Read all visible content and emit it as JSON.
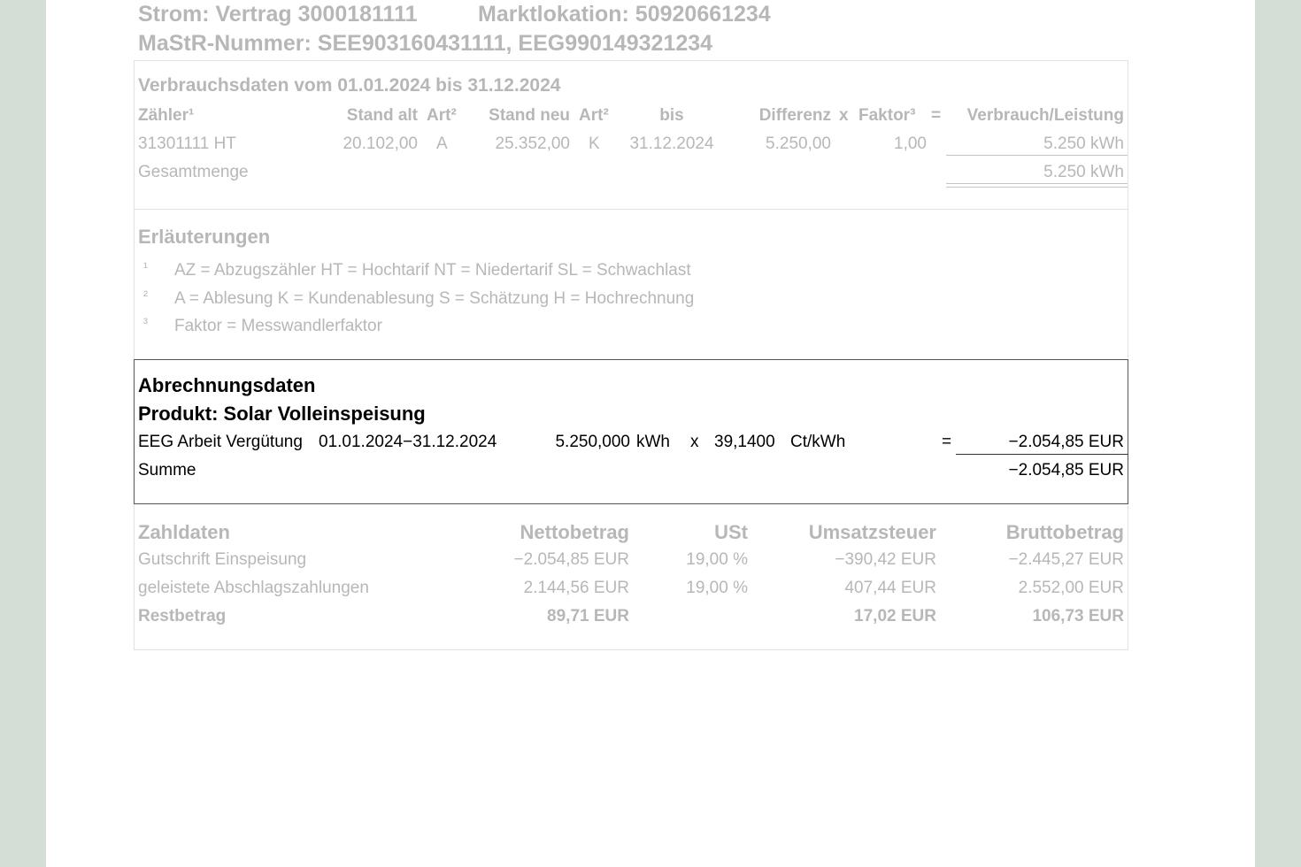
{
  "header": {
    "line1_contract": "Strom: Vertrag 3000181111",
    "line1_location": "Marktlokation: 50920661234",
    "line2": "MaStR-Nummer: SEE903160431111, EEG990149321234"
  },
  "consumption": {
    "title": "Verbrauchsdaten vom 01.01.2024 bis 31.12.2024",
    "headers": {
      "meter": "Zähler¹",
      "stand_alt": "Stand alt",
      "art1": "Art²",
      "stand_neu": "Stand neu",
      "art2": "Art²",
      "bis": "bis",
      "differenz": "Differenz",
      "x": "x",
      "faktor": "Faktor³",
      "eq": "=",
      "verbrauch": "Verbrauch/Leistung"
    },
    "row": {
      "meter": "31301111 HT",
      "stand_alt": "20.102,00",
      "art1": "A",
      "stand_neu": "25.352,00",
      "art2": "K",
      "bis": "31.12.2024",
      "differenz": "5.250,00",
      "faktor": "1,00",
      "verbrauch": "5.250 kWh"
    },
    "total_label": "Gesamtmenge",
    "total_value": "5.250 kWh"
  },
  "notes": {
    "title": "Erläuterungen",
    "items": [
      {
        "mark": "¹",
        "text": "AZ = Abzugszähler  HT = Hochtarif  NT = Niedertarif  SL = Schwachlast"
      },
      {
        "mark": "²",
        "text": "A = Ablesung  K = Kundenablesung  S = Schätzung  H = Hochrechnung"
      },
      {
        "mark": "³",
        "text": "Faktor = Messwandlerfaktor"
      }
    ]
  },
  "billing": {
    "title": "Abrechnungsdaten",
    "product": "Produkt: Solar Volleinspeisung",
    "line": {
      "label": "EEG Arbeit Vergütung",
      "period": "01.01.2024−31.12.2024",
      "qty": "5.250,000",
      "qty_unit": "kWh",
      "x": "x",
      "price": "39,1400",
      "price_unit": "Ct/kWh",
      "eq": "=",
      "amount": "−2.054,85 EUR"
    },
    "sum_label": "Summe",
    "sum_value": "−2.054,85 EUR"
  },
  "payment": {
    "headers": {
      "label": "Zahldaten",
      "netto": "Nettobetrag",
      "ust": "USt",
      "umsatzsteuer": "Umsatzsteuer",
      "brutto": "Bruttobetrag"
    },
    "rows": [
      {
        "label": "Gutschrift Einspeisung",
        "netto": "−2.054,85 EUR",
        "ust": "19,00 %",
        "umsatzsteuer": "−390,42 EUR",
        "brutto": "−2.445,27 EUR"
      },
      {
        "label": "geleistete Abschlagszahlungen",
        "netto": "2.144,56 EUR",
        "ust": "19,00 %",
        "umsatzsteuer": "407,44 EUR",
        "brutto": "2.552,00 EUR"
      }
    ],
    "rest": {
      "label": "Restbetrag",
      "netto": "89,71 EUR",
      "umsatzsteuer": "17,02 EUR",
      "brutto": "106,73 EUR"
    }
  }
}
